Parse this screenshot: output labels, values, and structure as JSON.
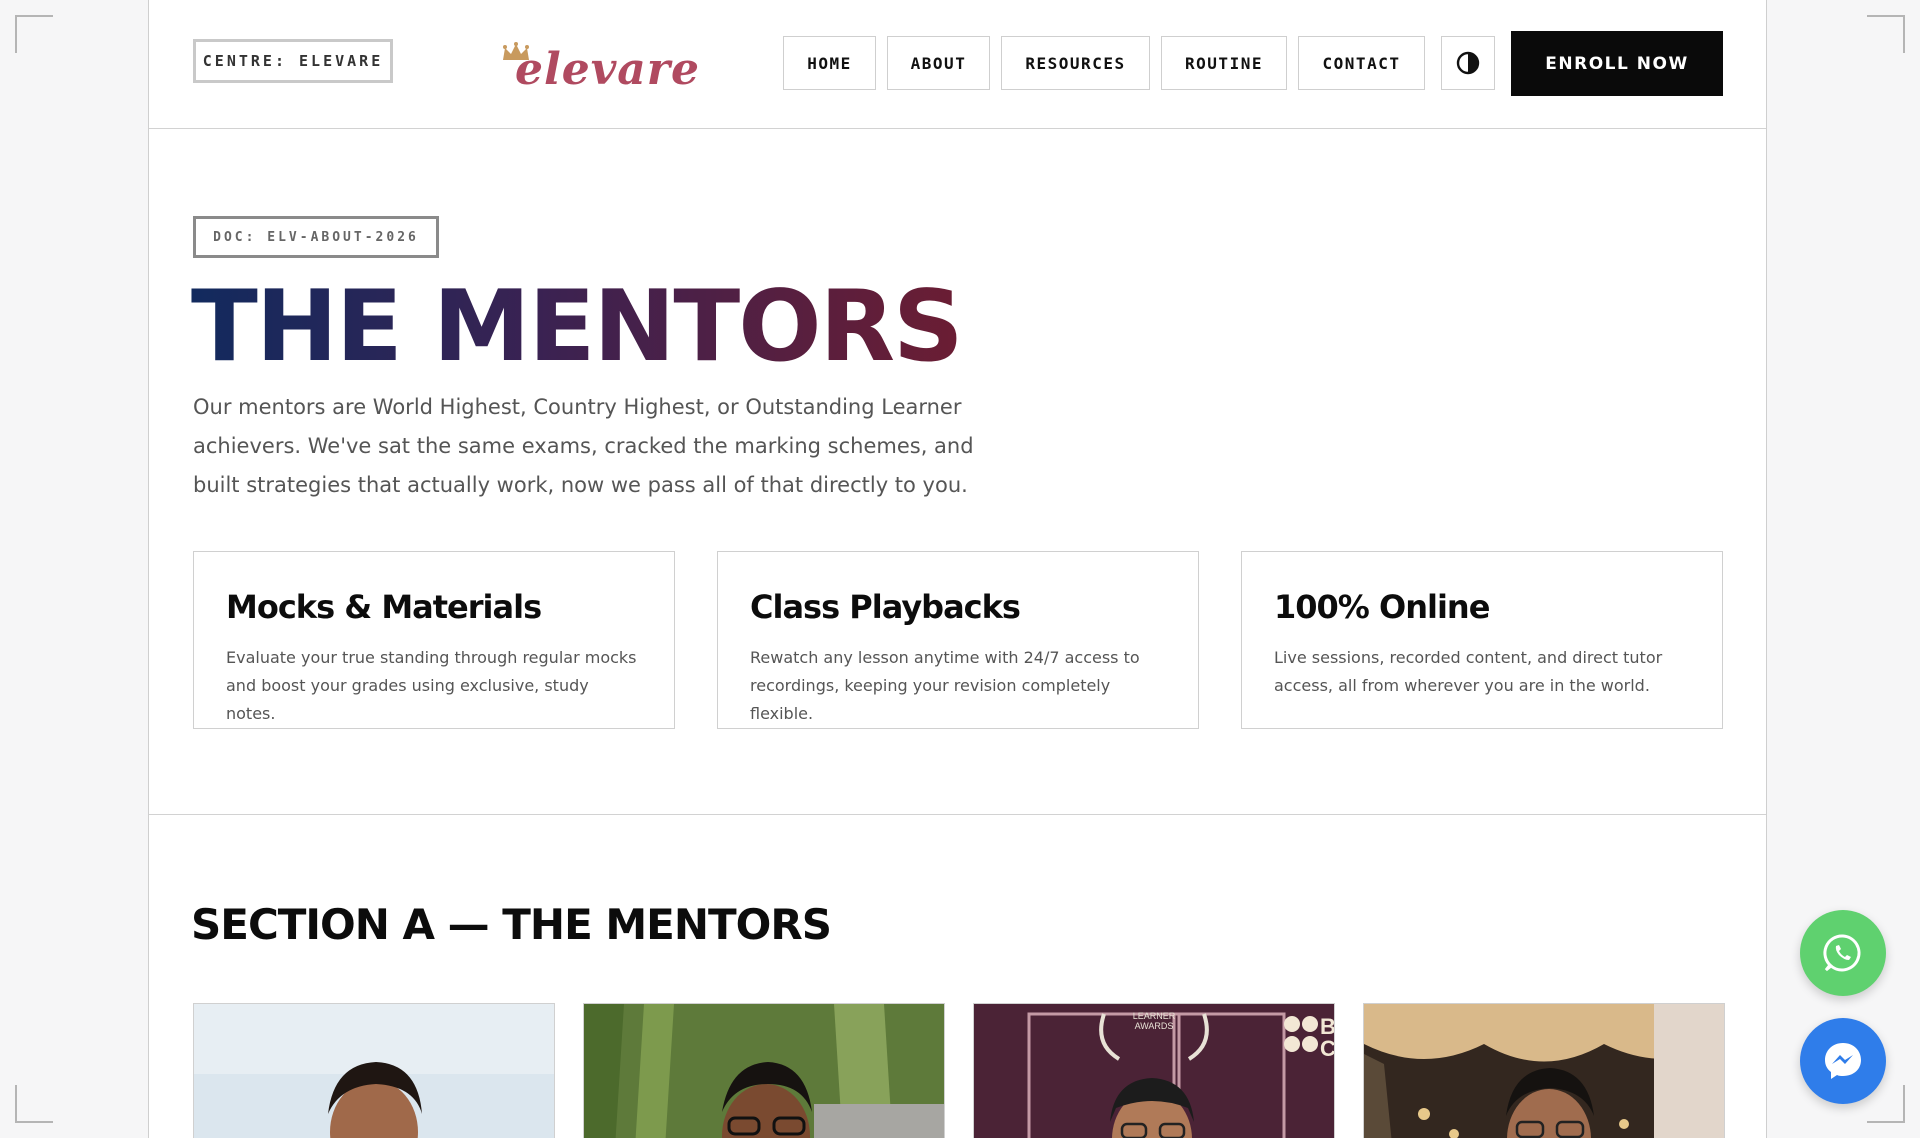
{
  "header": {
    "centre_label": "CENTRE: ELEVARE",
    "logo_text": "elevare",
    "nav": [
      "HOME",
      "ABOUT",
      "RESOURCES",
      "ROUTINE",
      "CONTACT"
    ],
    "enroll_label": "ENROLL NOW"
  },
  "hero": {
    "doc_tag": "DOC: ELV-ABOUT-2026",
    "title": "THE MENTORS",
    "description": "Our mentors are World Highest, Country Highest, or Outstanding Learner achievers. We've sat the same exams, cracked the marking schemes, and built strategies that actually work, now we pass all of that directly to you."
  },
  "features": [
    {
      "title": "Mocks & Materials",
      "text": "Evaluate your true standing through regular mocks and boost your grades using exclusive, study notes."
    },
    {
      "title": "Class Playbacks",
      "text": "Rewatch any lesson anytime with 24/7 access to recordings, keeping your revision completely flexible."
    },
    {
      "title": "100% Online",
      "text": "Live sessions, recorded content, and direct tutor access, all from wherever you are in the world."
    }
  ],
  "section_a": {
    "title": "SECTION A — THE MENTORS",
    "photo_text": {
      "award_line1": "LEARNER",
      "award_line2": "AWARDS",
      "partial_logo": "B",
      "partial_logo2": "C"
    }
  },
  "icons": {
    "theme_toggle": "contrast-icon",
    "crown": "crown-icon",
    "whatsapp": "whatsapp-icon",
    "messenger": "messenger-icon"
  },
  "colors": {
    "logo": "#b04a60",
    "title_gradient_start": "#122a5e",
    "title_gradient_end": "#6b1d33",
    "enroll_bg": "#0a0a0a",
    "whatsapp": "#5fd16f",
    "messenger": "#2f7dea"
  }
}
